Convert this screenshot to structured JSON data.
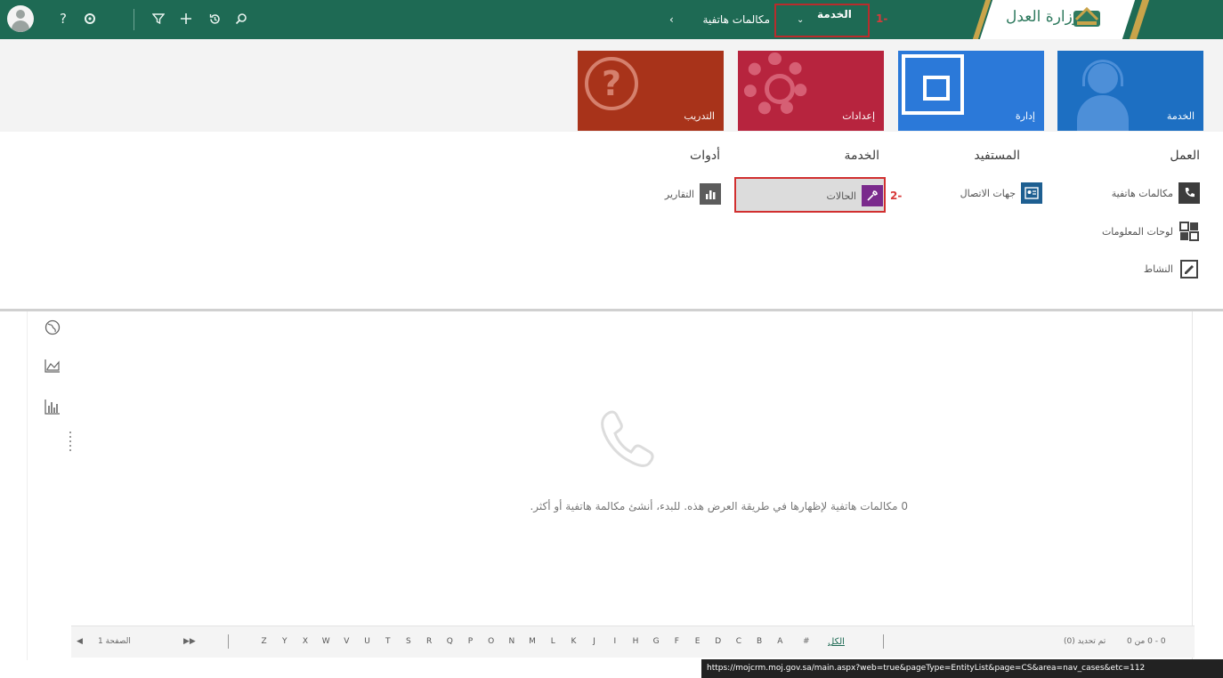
{
  "topbar": {
    "icons": [
      "avatar-icon",
      "help-icon",
      "settings-icon",
      "filter-icon",
      "add-icon",
      "history-icon",
      "search-icon"
    ],
    "help_glyph": "?",
    "breadcrumb": {
      "area": "الخدمة",
      "page": "مكالمات هاتفية"
    },
    "marker_1": "1-",
    "logo_text": "وزارة العدل"
  },
  "tiles": [
    {
      "label": "الخدمة"
    },
    {
      "label": "إدارة"
    },
    {
      "label": "إعدادات"
    },
    {
      "label": "التدريب"
    }
  ],
  "groups": {
    "work": {
      "title": "العمل",
      "items": [
        "مكالمات هاتفية",
        "لوحات المعلومات",
        "النشاط"
      ]
    },
    "customer": {
      "title": "المستفيد",
      "items": [
        "جهات الاتصال"
      ]
    },
    "service": {
      "title": "الخدمة",
      "items": [
        "الحالات"
      ]
    },
    "tools": {
      "title": "أدوات",
      "items": [
        "التقارير"
      ]
    },
    "marker_2": "2-"
  },
  "main": {
    "empty_message": "0 مكالمات هاتفية لإظهارها في طريقة العرض هذه. للبدء، أنشئ مكالمة هاتفية أو أكثر."
  },
  "footer": {
    "records": "0 - 0 من 0",
    "selected": "تم تحديد (0)",
    "all": "الكل",
    "hash": "#",
    "letters": [
      "A",
      "B",
      "C",
      "D",
      "E",
      "F",
      "G",
      "H",
      "I",
      "J",
      "K",
      "L",
      "M",
      "N",
      "O",
      "P",
      "Q",
      "R",
      "S",
      "T",
      "U",
      "V",
      "W",
      "X",
      "Y",
      "Z"
    ],
    "page_label": "الصفحة 1"
  },
  "status_url": "https://mojcrm.moj.gov.sa/main.aspx?web=true&pageType=EntityList&page=CS&area=nav_cases&etc=112"
}
